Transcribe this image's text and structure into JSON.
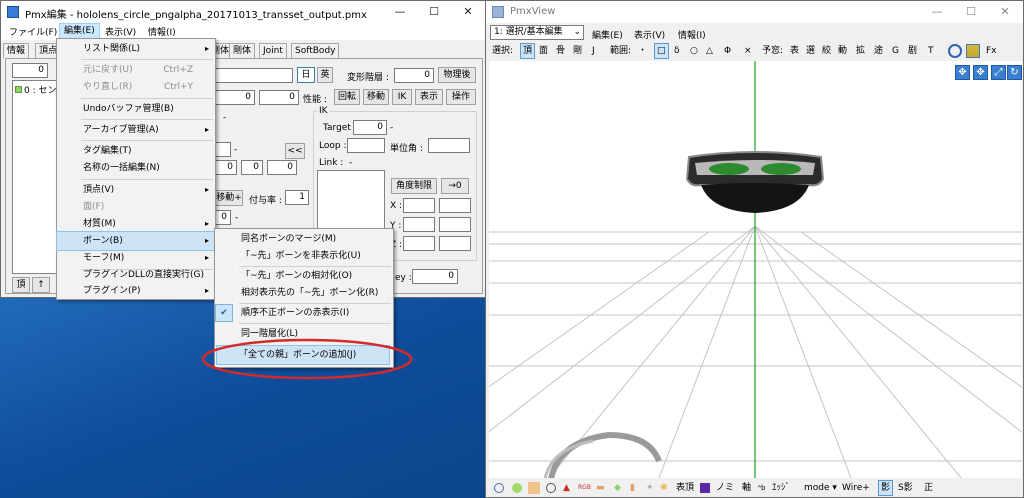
{
  "pmx_editor": {
    "title": "Pmx編集 - hololens_circle_pngalpha_20171013_transset_output.pmx",
    "menu": [
      "ファイル(F)",
      "編集(E)",
      "表示(V)",
      "情報(I)"
    ],
    "window_buttons": [
      "—",
      "☐",
      "✕"
    ],
    "tabs": [
      "情報",
      "頂点",
      "剛体",
      "剛体",
      "Joint",
      "SoftBody"
    ],
    "left_panel": {
      "field_value": "0",
      "list_item": "0 : センタ",
      "bottom_buttons": [
        "頂",
        "↑"
      ]
    },
    "right_panel": {
      "jp_btn": "日",
      "en_btn": "英",
      "deform_label": "変形階層 :",
      "deform_value": "0",
      "physics_after": "物理後",
      "pos_values": [
        "0",
        "0"
      ],
      "perf_label": "性能 :",
      "perf_buttons": [
        "回転",
        "移動",
        "IK",
        "表示",
        "操作"
      ],
      "ik_label": "IK",
      "target_label": "Target :",
      "target_value": "0",
      "loop_label": "Loop :",
      "unit_angle_label": "単位角 :",
      "link_label": "Link :",
      "link_dash": "-",
      "nav_btn": "<<",
      "fields_row": [
        "0",
        "0",
        "0"
      ],
      "grant_btn": "移動+",
      "grant_rate_label": "付与率 :",
      "grant_rate_value": "1",
      "field_zero": "0",
      "angle_limit_btn": "角度制限",
      "arrow_zero_btn": "→0",
      "axis_labels": [
        "X :",
        "Y :",
        "Z :"
      ],
      "key_label": "ey :",
      "key_value": "0"
    }
  },
  "edit_menu": {
    "items": [
      {
        "label": "リスト関係(L)",
        "shortcut": "",
        "arrow": "▸"
      },
      {
        "label": "元に戻す(U)",
        "shortcut": "Ctrl+Z",
        "arrow": ""
      },
      {
        "label": "やり直し(R)",
        "shortcut": "Ctrl+Y",
        "arrow": ""
      },
      {
        "label": "Undoバッファ管理(B)",
        "shortcut": "",
        "arrow": ""
      },
      {
        "label": "アーカイブ管理(A)",
        "shortcut": "",
        "arrow": "▸"
      },
      {
        "label": "タグ編集(T)",
        "shortcut": "",
        "arrow": ""
      },
      {
        "label": "名称の一括編集(N)",
        "shortcut": "",
        "arrow": ""
      },
      {
        "label": "頂点(V)",
        "shortcut": "",
        "arrow": "▸"
      },
      {
        "label": "面(F)",
        "shortcut": "",
        "arrow": ""
      },
      {
        "label": "材質(M)",
        "shortcut": "",
        "arrow": "▸"
      },
      {
        "label": "ボーン(B)",
        "shortcut": "",
        "arrow": "▸"
      },
      {
        "label": "モーフ(M)",
        "shortcut": "",
        "arrow": "▸"
      },
      {
        "label": "プラグインDLLの直接実行(G)",
        "shortcut": "",
        "arrow": ""
      },
      {
        "label": "プラグイン(P)",
        "shortcut": "",
        "arrow": "▸"
      }
    ]
  },
  "bone_submenu": {
    "items": [
      "同名ボーンのマージ(M)",
      "「~先」ボーンを非表示化(U)",
      "「~先」ボーンの相対化(O)",
      "相対表示先の「~先」ボーン化(R)",
      "順序不正ボーンの赤表示(I)",
      "同一階層化(L)",
      "「全ての親」ボーンの追加(J)"
    ],
    "check": "✔"
  },
  "pmx_view": {
    "title": "PmxView",
    "window_buttons": [
      "—",
      "☐",
      "✕"
    ],
    "mode_select": "1: 選択/基本編集",
    "menu": [
      "編集(E)",
      "表示(V)",
      "情報(I)"
    ],
    "select_label": "選択:",
    "select_items": [
      "頂",
      "面",
      "骨",
      "剛",
      "J"
    ],
    "range_label": "範囲:",
    "range_items": [
      "・",
      "□",
      "δ",
      "○",
      "△",
      "Φ",
      "×"
    ],
    "yoyaku_label": "予窓:",
    "yoyaku_items": [
      "表",
      "選",
      "絞",
      "動",
      "拡",
      "途",
      "G",
      "剧",
      "T"
    ],
    "fx_label": "Fx",
    "bottom_labels": [
      "表頂",
      "ノミ",
      "軸",
      "ｴｯｼﾞ",
      "mode ▾",
      "Wire+",
      "影",
      "S影",
      "正"
    ]
  },
  "colors": {
    "highlight": "#cde4f7",
    "annotation": "#d42a2a",
    "axis_green": "#1aa31a",
    "desktop": "#1f5fb0"
  }
}
